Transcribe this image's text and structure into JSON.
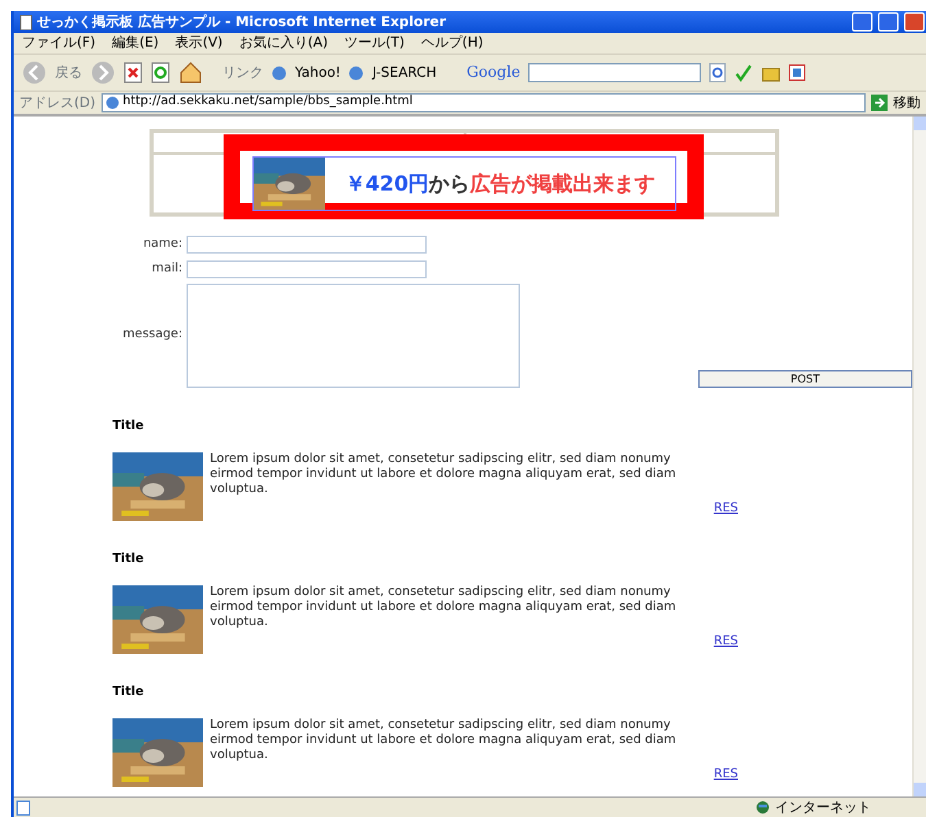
{
  "window": {
    "title": "せっかく掲示板  広告サンプル - Microsoft Internet Explorer"
  },
  "menu": [
    "ファイル(F)",
    "編集(E)",
    "表示(V)",
    "お気に入り(A)",
    "ツール(T)",
    "ヘルプ(H)"
  ],
  "toolbar": {
    "back": "戻る",
    "links_label": "リンク",
    "links": [
      "Yahoo!",
      "J-SEARCH"
    ],
    "google": "Google"
  },
  "address_bar": {
    "label": "アドレス(D)",
    "url": "http://ad.sekkaku.net/sample/bbs_sample.html",
    "go": "移動"
  },
  "ad": {
    "segments": [
      {
        "text": "￥420円",
        "kind": "price"
      },
      {
        "text": "から",
        "kind": "plain"
      },
      {
        "text": "広告が掲載出来ます",
        "kind": "accent"
      }
    ]
  },
  "form": {
    "fields": [
      {
        "label": "name:",
        "kind": "text"
      },
      {
        "label": "mail:",
        "kind": "text"
      },
      {
        "label": "message:",
        "kind": "textarea"
      }
    ],
    "submit": "POST"
  },
  "posts": [
    {
      "title": "Title",
      "body": "Lorem ipsum dolor sit amet, consetetur sadipscing elitr, sed diam nonumy eirmod tempor invidunt ut labore et dolore magna aliquyam erat, sed diam voluptua.",
      "link": "RES"
    },
    {
      "title": "Title",
      "body": "Lorem ipsum dolor sit amet, consetetur sadipscing elitr, sed diam nonumy eirmod tempor invidunt ut labore et dolore magna aliquyam erat, sed diam voluptua.",
      "link": "RES"
    },
    {
      "title": "Title",
      "body": "Lorem ipsum dolor sit amet, consetetur sadipscing elitr, sed diam nonumy eirmod tempor invidunt ut labore et dolore magna aliquyam erat, sed diam voluptua.",
      "link": "RES"
    }
  ],
  "status_bar": {
    "zone": "インターネット"
  }
}
